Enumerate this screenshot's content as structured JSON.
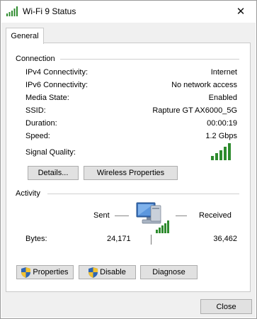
{
  "window": {
    "title": "Wi-Fi 9 Status"
  },
  "tabs": [
    {
      "label": "General"
    }
  ],
  "connection": {
    "heading": "Connection",
    "rows": [
      {
        "label": "IPv4 Connectivity:",
        "value": "Internet"
      },
      {
        "label": "IPv6 Connectivity:",
        "value": "No network access"
      },
      {
        "label": "Media State:",
        "value": "Enabled"
      },
      {
        "label": "SSID:",
        "value": "Rapture GT AX6000_5G"
      },
      {
        "label": "Duration:",
        "value": "00:00:19"
      },
      {
        "label": "Speed:",
        "value": "1.2 Gbps"
      }
    ],
    "signal_label": "Signal Quality:",
    "signal_bars": 5,
    "signal_max": 5,
    "details_button": "Details...",
    "wireless_button": "Wireless Properties"
  },
  "activity": {
    "heading": "Activity",
    "sent_label": "Sent",
    "received_label": "Received",
    "bytes_label": "Bytes:",
    "bytes_sent": "24,171",
    "bytes_received": "36,462"
  },
  "buttons": {
    "properties": "Properties",
    "disable": "Disable",
    "diagnose": "Diagnose",
    "close": "Close"
  },
  "colors": {
    "signal_green": "#2e8b2e",
    "button_face": "#e1e1e1"
  },
  "icons": [
    "wifi-signal-icon",
    "close-x-icon",
    "uac-shield-icon",
    "network-computer-icon"
  ]
}
